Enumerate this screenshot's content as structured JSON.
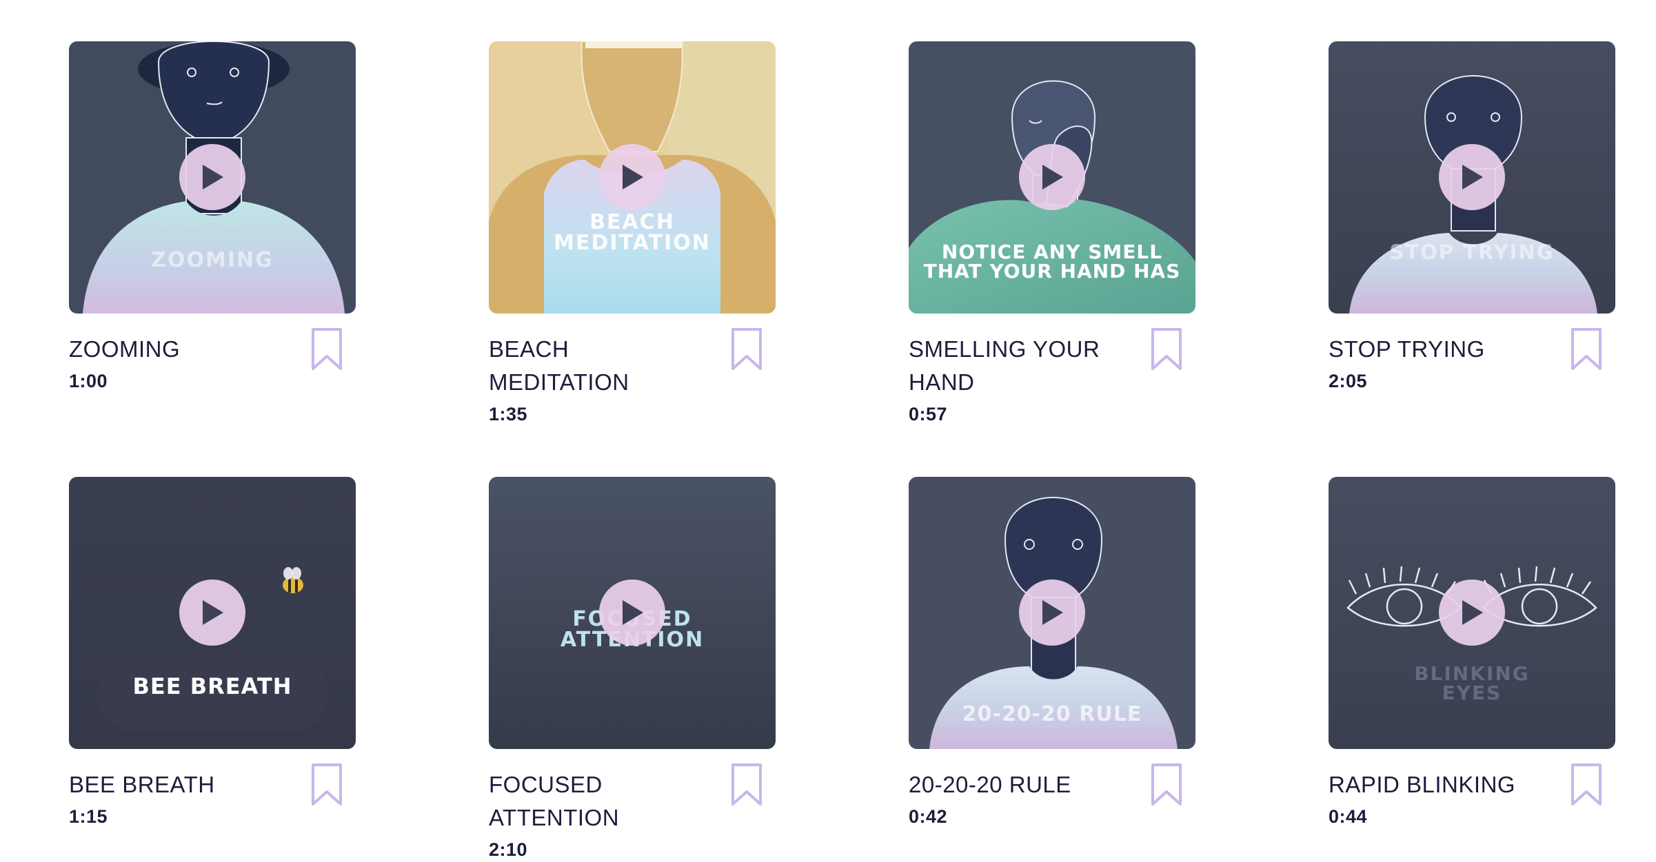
{
  "colors": {
    "title_text": "#1b1e3a",
    "bookmark_stroke": "#c9b6ec",
    "play_button_bg": "#ebd0ec",
    "play_glyph": "#3e4157"
  },
  "videos": [
    {
      "title": "ZOOMING",
      "duration": "1:00",
      "overlay": "ZOOMING",
      "icon": "play-icon"
    },
    {
      "title": "BEACH MEDITATION",
      "duration": "1:35",
      "overlay_line1": "BEACH",
      "overlay_line2": "MEDITATION",
      "icon": "play-icon"
    },
    {
      "title": "SMELLING YOUR HAND",
      "duration": "0:57",
      "overlay_line1": "NOTICE ANY SMELL",
      "overlay_line2": "THAT YOUR HAND HAS",
      "icon": "play-icon"
    },
    {
      "title": "STOP TRYING",
      "duration": "2:05",
      "overlay": "STOP TRYING",
      "icon": "play-icon"
    },
    {
      "title": "BEE BREATH",
      "duration": "1:15",
      "overlay": "BEE BREATH",
      "icon": "play-icon"
    },
    {
      "title": "FOCUSED ATTENTION",
      "duration": "2:10",
      "overlay_line1": "FOCUSED",
      "overlay_line2": "ATTENTION",
      "icon": "play-icon"
    },
    {
      "title": "20-20-20 RULE",
      "duration": "0:42",
      "overlay": "20-20-20 RULE",
      "icon": "play-icon"
    },
    {
      "title": "RAPID BLINKING",
      "duration": "0:44",
      "overlay_line1": "BLINKING",
      "overlay_line2": "EYES",
      "icon": "play-icon"
    }
  ]
}
